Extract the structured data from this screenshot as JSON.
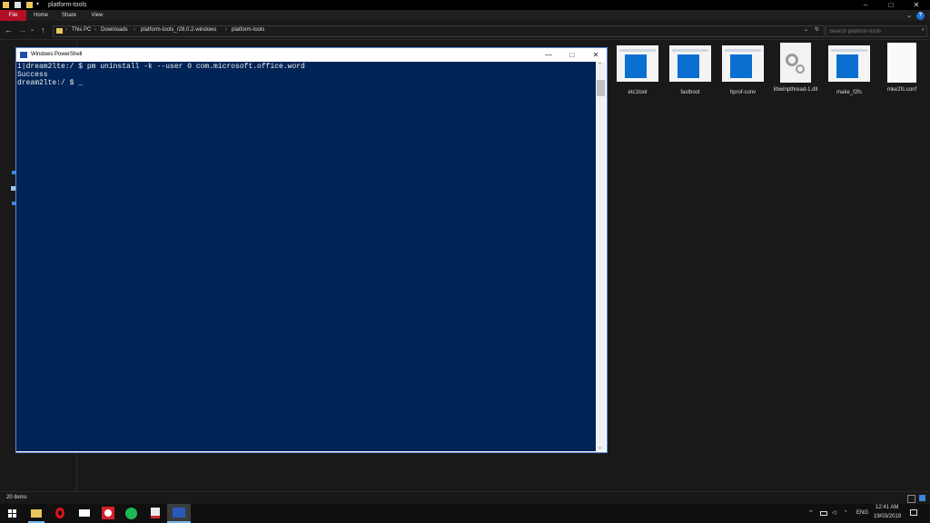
{
  "explorer": {
    "title": "platform-tools",
    "ribbon_tabs": [
      "File",
      "Home",
      "Share",
      "View"
    ],
    "help": "?",
    "window_controls": [
      "–",
      "□",
      "✕"
    ],
    "breadcrumbs": [
      "This PC",
      "Downloads",
      "platform-tools_r28.0.2-windows",
      "platform-tools"
    ],
    "search_placeholder": "Search platform-tools",
    "files": [
      {
        "name": "etc1tool",
        "icon": "app-icon"
      },
      {
        "name": "fastboot",
        "icon": "app-icon"
      },
      {
        "name": "hprof-conv",
        "icon": "app-icon"
      },
      {
        "name": "libwinpthread-1.dll",
        "icon": "dll-gear-icon"
      },
      {
        "name": "make_f2fs",
        "icon": "app-icon"
      },
      {
        "name": "mke2fs.conf",
        "icon": "blank-file-icon"
      }
    ],
    "status": "20 items"
  },
  "powershell": {
    "title": "Windows PowerShell",
    "window_controls": [
      "—",
      "□",
      "✕"
    ],
    "lines": [
      "1|dream2lte:/ $ pm uninstall -k --user 0 com.microsoft.office.word",
      "Success",
      "dream2lte:/ $ _"
    ],
    "console_bg": "#012456"
  },
  "taskbar": {
    "apps": [
      "start-icon",
      "file-explorer-icon",
      "opera-icon",
      "mail-icon",
      "whatsapp-icon",
      "spotify-icon",
      "popcorn-icon",
      "powershell-icon"
    ],
    "tray": {
      "language": "ENG",
      "time": "12:41 AM",
      "date": "19/03/2019"
    }
  }
}
